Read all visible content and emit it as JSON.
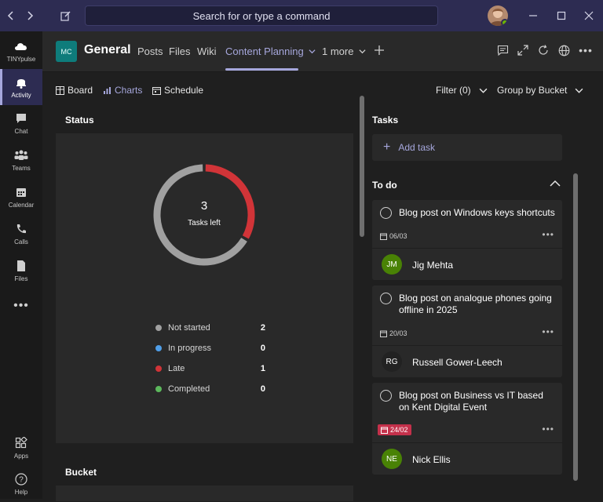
{
  "titlebar": {
    "search_text": "Search for or type a command"
  },
  "rail": {
    "items": [
      {
        "label": "TINYpulse",
        "icon": "tinypulse-cloud-icon"
      },
      {
        "label": "Activity",
        "icon": "bell-icon"
      },
      {
        "label": "Chat",
        "icon": "chat-icon"
      },
      {
        "label": "Teams",
        "icon": "teams-icon"
      },
      {
        "label": "Calendar",
        "icon": "calendar-icon"
      },
      {
        "label": "Calls",
        "icon": "phone-icon"
      },
      {
        "label": "Files",
        "icon": "file-icon"
      },
      {
        "label": "Apps",
        "icon": "apps-icon"
      },
      {
        "label": "Help",
        "icon": "help-icon"
      }
    ]
  },
  "header": {
    "team_initials": "MC",
    "channel_name": "General",
    "tabs": [
      {
        "label": "Posts"
      },
      {
        "label": "Files"
      },
      {
        "label": "Wiki"
      },
      {
        "label": "Content Planning"
      },
      {
        "label": "1 more"
      }
    ]
  },
  "toolbar": {
    "board": "Board",
    "charts": "Charts",
    "schedule": "Schedule",
    "filter": "Filter (0)",
    "group_by": "Group by Bucket"
  },
  "status": {
    "title": "Status",
    "count": "3",
    "count_label": "Tasks left",
    "legend": [
      {
        "label": "Not started",
        "value": "2",
        "color": "#a0a0a0"
      },
      {
        "label": "In progress",
        "value": "0",
        "color": "#4f9ee8"
      },
      {
        "label": "Late",
        "value": "1",
        "color": "#d13438"
      },
      {
        "label": "Completed",
        "value": "0",
        "color": "#5cb85c"
      }
    ]
  },
  "bucket": {
    "title": "Bucket"
  },
  "tasks": {
    "title": "Tasks",
    "add_task": "Add task",
    "todo_title": "To do",
    "items": [
      {
        "title": "Blog post on Windows keys shortcuts",
        "date": "06/03",
        "late": false,
        "assignee": "Jig Mehta",
        "initials": "JM",
        "avatar_color": "#498205"
      },
      {
        "title": "Blog post on analogue phones going offline in 2025",
        "date": "20/03",
        "late": false,
        "assignee": "Russell Gower-Leech",
        "initials": "RG",
        "avatar_color": "#222222"
      },
      {
        "title": "Blog post on Business vs IT based on Kent Digital Event",
        "date": "24/02",
        "late": true,
        "assignee": "Nick Ellis",
        "initials": "NE",
        "avatar_color": "#498205"
      }
    ]
  }
}
